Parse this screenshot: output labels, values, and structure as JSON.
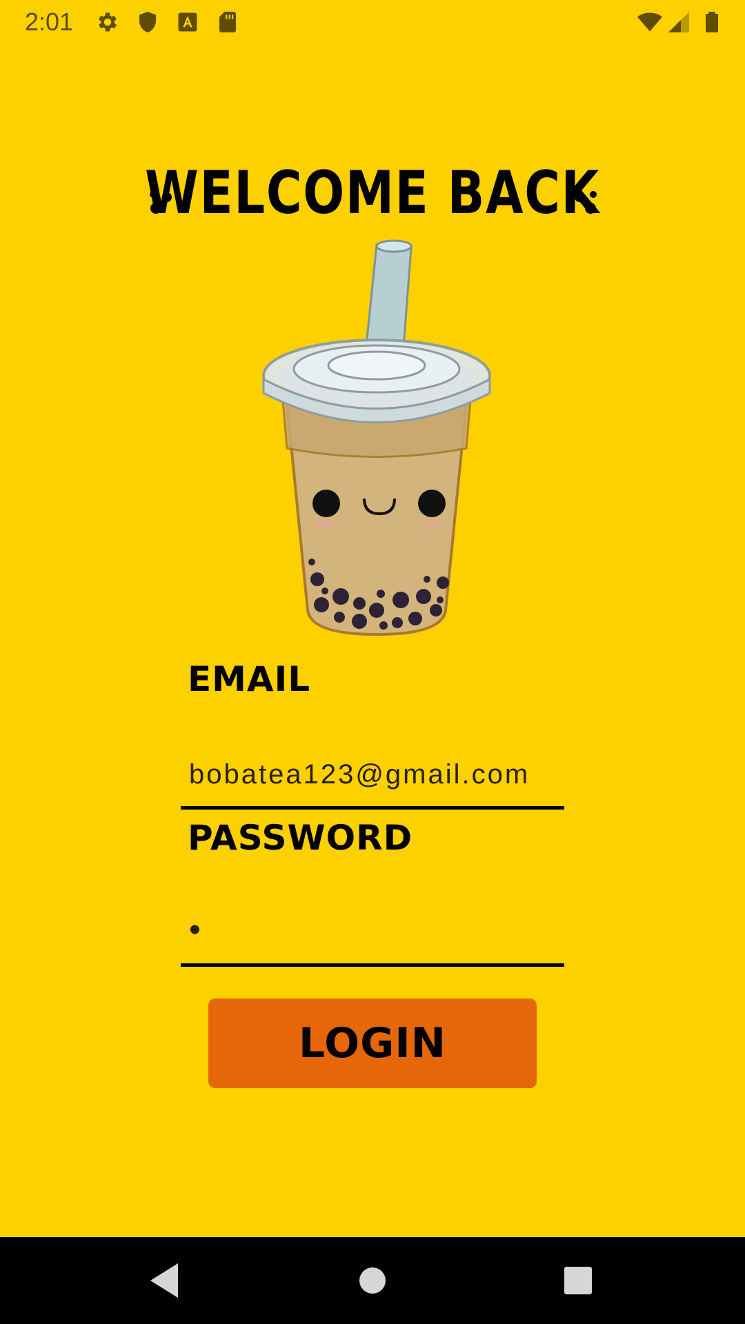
{
  "status_bar": {
    "time": "2:01",
    "icons": [
      "gear-icon",
      "shield-icon",
      "font-a-icon",
      "sd-card-icon",
      "wifi-icon",
      "cell-signal-icon",
      "battery-icon"
    ]
  },
  "header": {
    "title": "WELCOME BACK"
  },
  "illustration": {
    "icon": "boba-tea-icon"
  },
  "form": {
    "email_label": "EMAIL",
    "email_value": "bobatea123@gmail.com",
    "password_label": "PASSWORD",
    "password_value": "•",
    "login_label": "LOGIN"
  },
  "nav": {
    "back": "back-icon",
    "home": "home-icon",
    "recents": "recents-icon"
  },
  "colors": {
    "background": "#FDD000",
    "button": "#E5670A",
    "text": "#000000"
  }
}
